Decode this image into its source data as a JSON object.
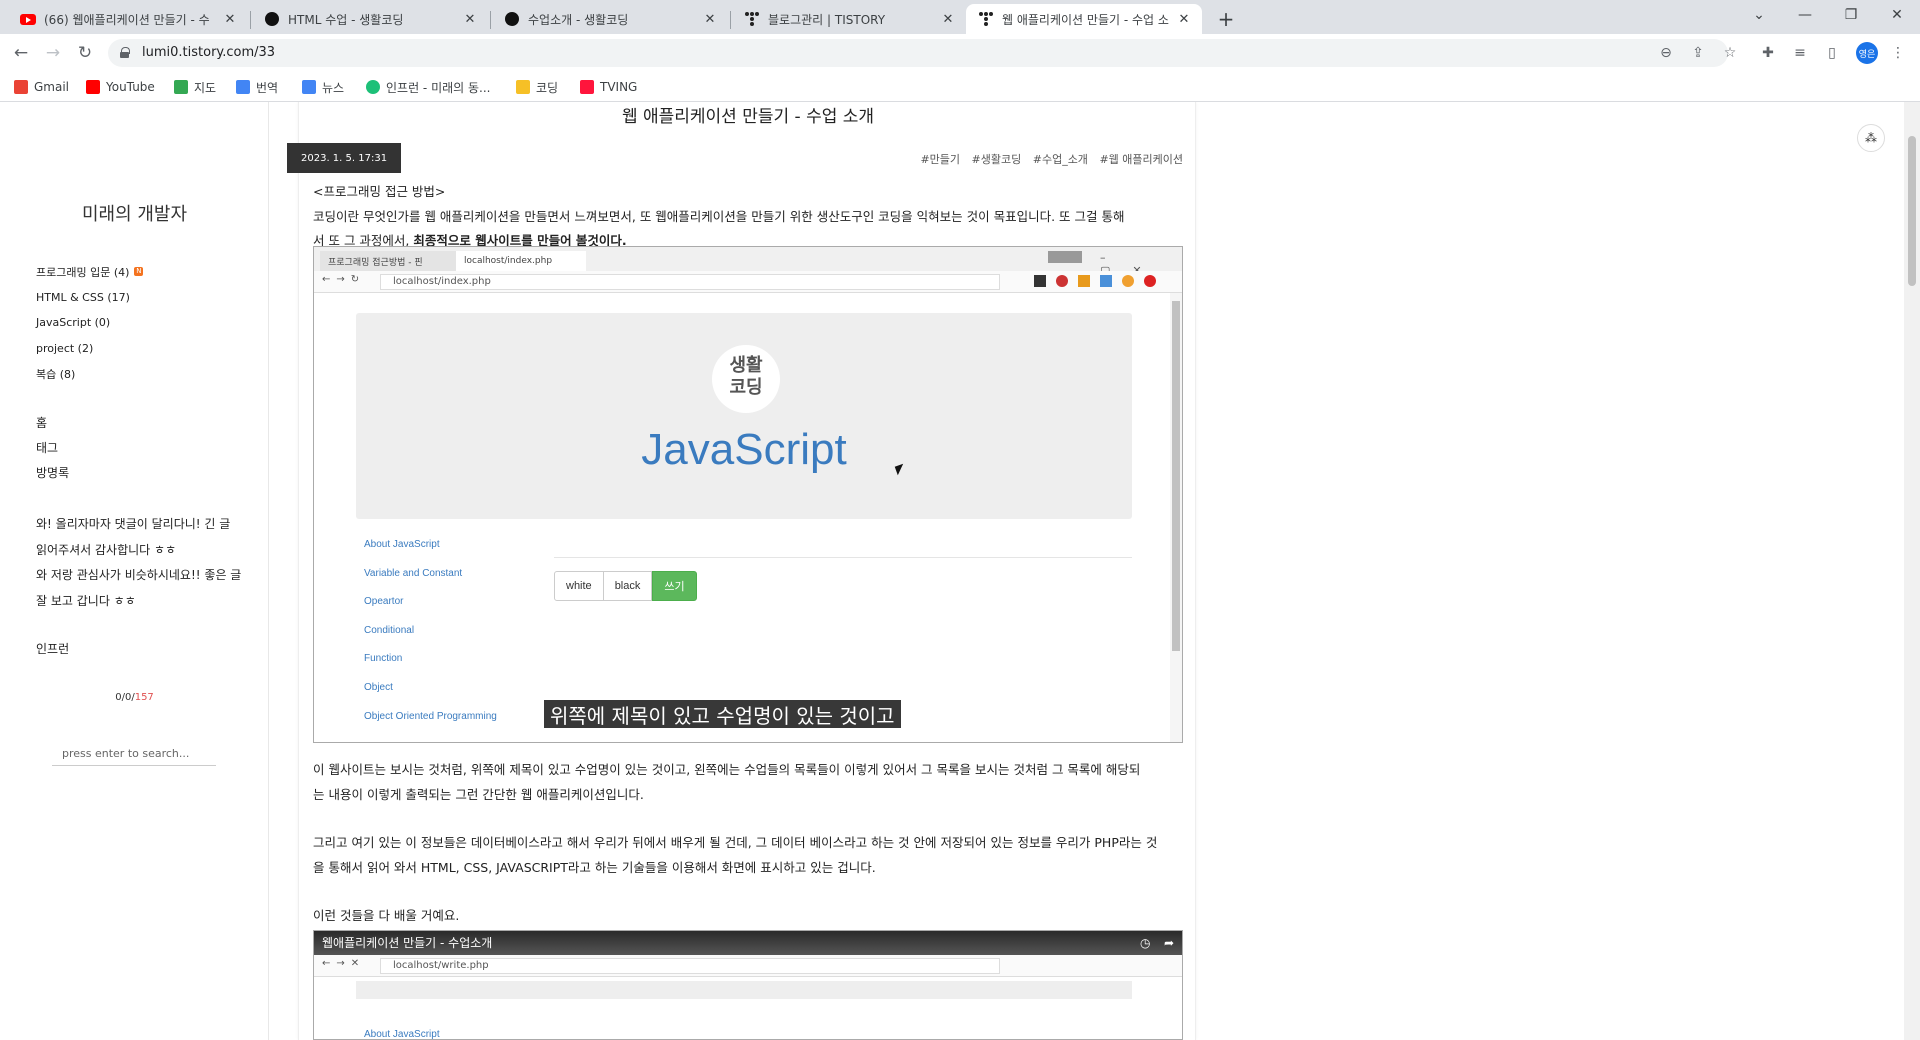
{
  "browser": {
    "tabs": [
      {
        "title": "(66) 웹애플리케이션 만들기 - 수",
        "favicon": "youtube-icon"
      },
      {
        "title": "HTML 수업 - 생활코딩",
        "favicon": "opentutorials-icon"
      },
      {
        "title": "수업소개 - 생활코딩",
        "favicon": "opentutorials-icon"
      },
      {
        "title": "블로그관리 | TISTORY",
        "favicon": "tistory-icon"
      },
      {
        "title": "웹 애플리케이션 만들기 - 수업 소",
        "favicon": "tistory-icon"
      }
    ],
    "url": "lumi0.tistory.com/33",
    "profile_initials": "영은",
    "bookmarks": [
      {
        "label": "Gmail",
        "color": "#ea4335"
      },
      {
        "label": "YouTube",
        "color": "#ff0000"
      },
      {
        "label": "지도",
        "color": "#34a853"
      },
      {
        "label": "번역",
        "color": "#4285f4"
      },
      {
        "label": "뉴스",
        "color": "#4285f4"
      },
      {
        "label": "인프런 - 미래의 동...",
        "color": "#1dc078"
      },
      {
        "label": "코딩",
        "color": "#f6c026"
      },
      {
        "label": "TVING",
        "color": "#ff153c"
      }
    ]
  },
  "sidebar": {
    "blog_title": "미래의 개발자",
    "categories": [
      {
        "label": "프로그래밍 입문 (4)"
      },
      {
        "label": "HTML & CSS (17)"
      },
      {
        "label": "JavaScript (0)"
      },
      {
        "label": "project (2)"
      },
      {
        "label": "복습 (8)"
      }
    ],
    "menu": [
      "홈",
      "태그",
      "방명록"
    ],
    "recent_comments": [
      "와! 올리자마자 댓글이 달리다니! 긴 글",
      "읽어주셔서 감사합니다 ㅎㅎ",
      "와 저랑 관심사가 비슷하시네요!! 좋은 글",
      "잘 보고 갑니다 ㅎㅎ"
    ],
    "inflearn_label": "인프런",
    "counter": {
      "today": "0",
      "yesterday": "0",
      "total": "157",
      "sep": "/"
    },
    "search_placeholder": "press enter to search..."
  },
  "post": {
    "title": "웹 애플리케이션 만들기 - 수업 소개",
    "date": "2023. 1. 5. 17:31",
    "tags": [
      "#만들기",
      "#생활코딩",
      "#수업_소개",
      "#웹 애플리케이션"
    ],
    "section_heading": "<프로그래밍 접근 방법>",
    "intro_1": "코딩이란 무엇인가를 웹 애플리케이션을 만들면서 느껴보면서, 또 웹애플리케이션을 만들기 위한 생산도구인 코딩을 익혀보는 것이 목표입니다. 또 그걸 통해",
    "intro_2a": "서 또 그 과정에서, ",
    "intro_2b": "최종적으로 웹사이트를 만들어 볼것이다.",
    "para1_line1": "이 웹사이트는 보시는 것처럼, 위쪽에 제목이 있고 수업명이 있는 것이고, 왼쪽에는 수업들의 목록들이 이렇게 있어서 그 목록을 보시는 것처럼 그 목록에 해당되",
    "para1_line2": "는 내용이 이렇게 출력되는 그런 간단한 웹 애플리케이션입니다.",
    "para2_line1": "그리고 여기 있는 이 정보들은 데이터베이스라고 해서 우리가 뒤에서 배우게 될 건데, 그 데이터 베이스라고 하는 것 안에 저장되어 있는 정보를 우리가 PHP라는 것",
    "para2_line2": "을 통해서 읽어 와서 HTML, CSS, JAVASCRIPT라고 하는 기술들을 이용해서 화면에 표시하고 있는 겁니다.",
    "para3": "이런 것들을 다 배울 거예요."
  },
  "video1": {
    "tab1": "프로그래밍 접근방법 - 핀",
    "tab2": "localhost/index.php",
    "url": "localhost/index.php",
    "logo_top": "생활",
    "logo_bottom": "코딩",
    "hero_title": "JavaScript",
    "nav": [
      "About JavaScript",
      "Variable and Constant",
      "Opeartor",
      "Conditional",
      "Function",
      "Object",
      "Object Oriented Programming"
    ],
    "buttons": [
      "white",
      "black",
      "쓰기"
    ],
    "subtitle": "위쪽에 제목이 있고 수업명이 있는 것이고"
  },
  "video2": {
    "title": "웹애플리케이션 만들기 - 수업소개",
    "url": "localhost/write.php",
    "nav_first": "About JavaScript"
  },
  "colors": {
    "accent_orange": "#f4731f",
    "link_blue": "#3a7bbf",
    "green_button": "#5cb85c",
    "counter_red": "#e05050"
  }
}
